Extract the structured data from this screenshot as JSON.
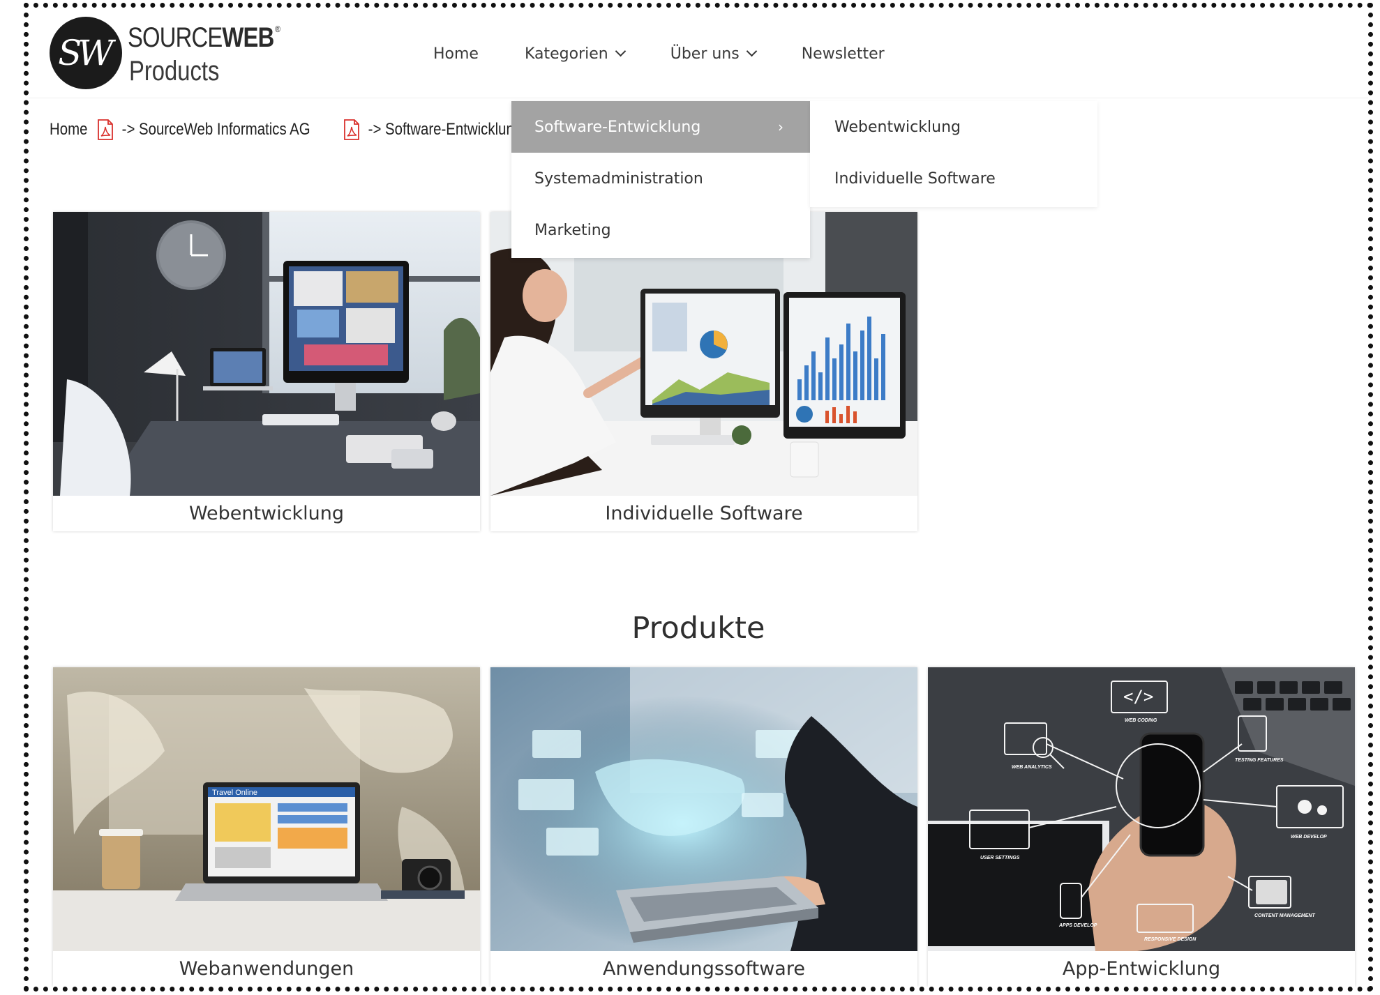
{
  "brand": {
    "logo_initials": "SW",
    "name_part1": "SOURCE",
    "name_part2": "WEB",
    "registered": "®",
    "subtitle": "Products"
  },
  "nav": {
    "home": "Home",
    "kategorien": "Kategorien",
    "ueber_uns": "Über uns",
    "newsletter": "Newsletter"
  },
  "breadcrumb": {
    "items": [
      "Home",
      "SourceWeb Informatics AG",
      "Software-Entwicklung"
    ],
    "separator": "->",
    "icon": "pdf-icon"
  },
  "dropdown": {
    "items": [
      "Software-Entwicklung",
      "Systemadministration",
      "Marketing"
    ],
    "active_index": 0,
    "submenu": [
      "Webentwicklung",
      "Individuelle Software"
    ],
    "active_color": "#a3a3a3"
  },
  "categories": [
    {
      "label": "Webentwicklung",
      "image": "desk-with-monitor-and-laptop-photo"
    },
    {
      "label": "Individuelle Software",
      "image": "woman-analyzing-charts-photo"
    }
  ],
  "products": {
    "title": "Produkte",
    "items": [
      {
        "label": "Webanwendungen",
        "image": "laptop-travel-online-photo",
        "screen_text": "Travel Online"
      },
      {
        "label": "Anwendungssoftware",
        "image": "digital-world-laptop-photo"
      },
      {
        "label": "App-Entwicklung",
        "image": "smartphone-icons-photo",
        "icon_texts": [
          "</>",
          "WEB CODING",
          "WEB ANALYTICS",
          "TESTING FEATURES",
          "USER SETTINGS",
          "WEB DEVELOP",
          "APPS DEVELOP",
          "RESPONSIVE DESIGN",
          "CONTENT MANAGEMENT"
        ]
      }
    ]
  },
  "colors": {
    "pdf_red": "#d9302c",
    "text": "#333333"
  }
}
